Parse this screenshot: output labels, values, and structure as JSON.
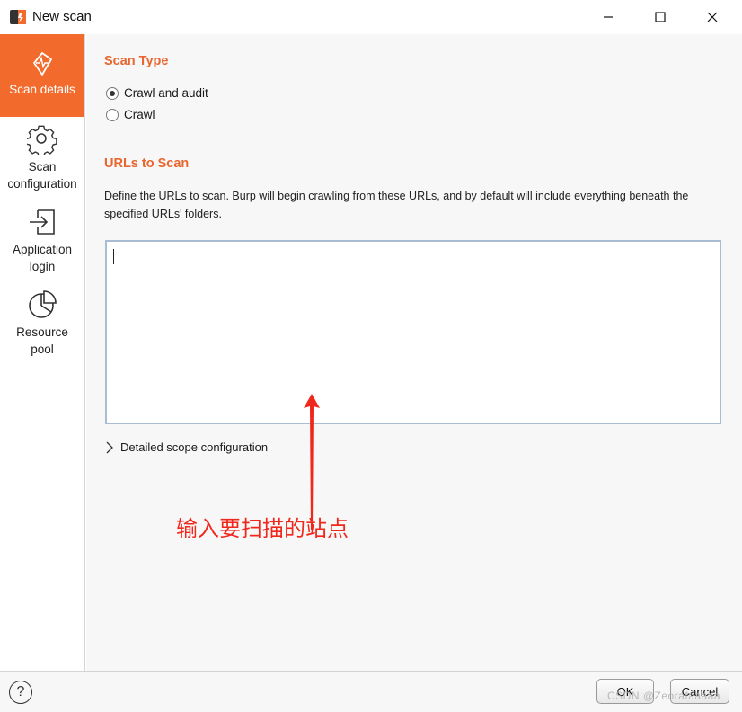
{
  "window": {
    "title": "New scan"
  },
  "sidebar": {
    "items": [
      {
        "label": "Scan details",
        "icon": "scan-details-icon",
        "active": true
      },
      {
        "label": "Scan configuration",
        "icon": "gear-icon",
        "active": false
      },
      {
        "label": "Application login",
        "icon": "login-icon",
        "active": false
      },
      {
        "label": "Resource pool",
        "icon": "pie-chart-icon",
        "active": false
      }
    ]
  },
  "scan_type": {
    "heading": "Scan Type",
    "options": [
      {
        "label": "Crawl and audit",
        "selected": true
      },
      {
        "label": "Crawl",
        "selected": false
      }
    ]
  },
  "urls": {
    "heading": "URLs to Scan",
    "description": "Define the URLs to scan. Burp will begin crawling from these URLs, and by default will include everything beneath the specified URLs' folders.",
    "value": ""
  },
  "scope": {
    "label": "Detailed scope configuration"
  },
  "annotation": {
    "text": "输入要扫描的站点",
    "color": "#f0281c"
  },
  "footer": {
    "help": "?",
    "ok_label": "OK",
    "cancel_label": "Cancel",
    "watermark": "CSDN @Zeorafaaaaa"
  },
  "colors": {
    "accent": "#f26b2d",
    "heading": "#e8662f"
  }
}
